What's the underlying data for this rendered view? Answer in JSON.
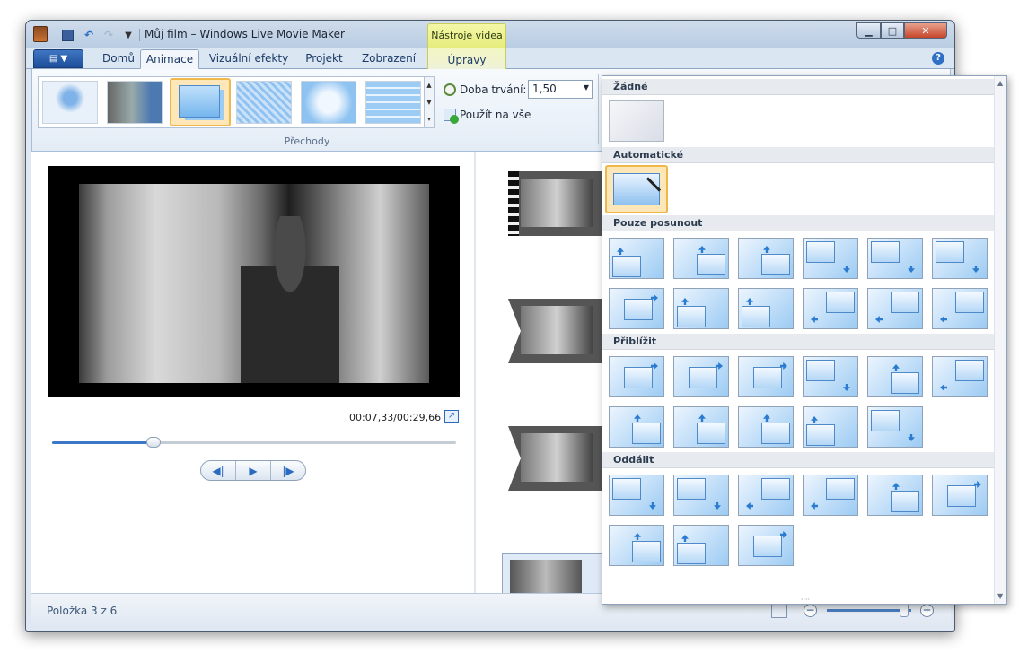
{
  "window": {
    "title": "Můj film – Windows Live Movie Maker",
    "context_tab_title": "Nástroje videa"
  },
  "ribbon": {
    "tabs": [
      "Domů",
      "Animace",
      "Vizuální efekty",
      "Projekt",
      "Zobrazení",
      "Úpravy"
    ],
    "active_tab": "Animace",
    "group_label": "Přechody",
    "duration_label": "Doba trvání:",
    "duration_value": "1,50",
    "apply_all_label": "Použít na vše"
  },
  "player": {
    "timecode": "00:07,33/00:29,66",
    "seek_position": 0.25
  },
  "status": {
    "item_text": "Položka 3 z 6",
    "zoom_position": 0.92
  },
  "panel": {
    "sections": [
      "Žádné",
      "Automatické",
      "Pouze posunout",
      "Přiblížit",
      "Oddálit"
    ]
  },
  "colors": {
    "accent": "#3d78c8",
    "selection": "#f0b84b",
    "context_tab": "#e6ec7c"
  }
}
